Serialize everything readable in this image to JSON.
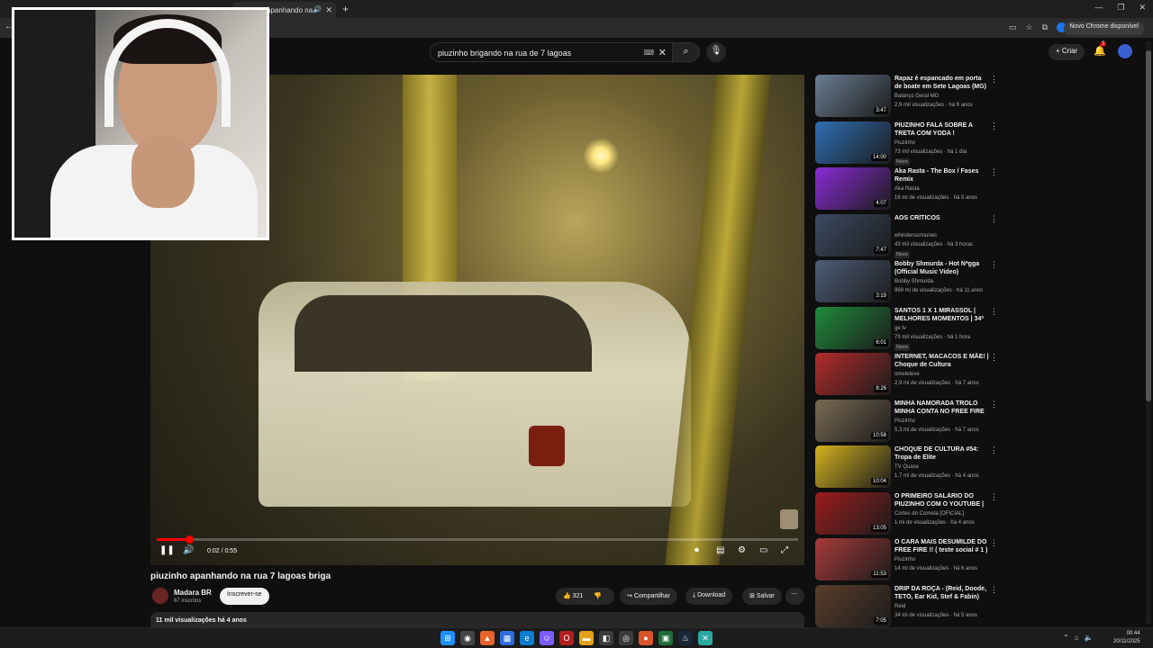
{
  "browser": {
    "tab_title": "pluzinho apanhando na",
    "update_label": "Novo Chrome disponível"
  },
  "youtube": {
    "search_value": "piuzinho brigando na rua de 7 lagoas",
    "create_label": "Criar",
    "notifications_count": "3",
    "video": {
      "title": "piuzinho apanhando na rua 7 lagoas briga",
      "time": "0:02 / 0:55",
      "progress_fraction": 0.05,
      "channel": "Madara BR",
      "subs": "67 inscritos",
      "subscribe": "Inscrever-se",
      "likes": "321",
      "share": "Compartilhar",
      "download": "Download",
      "save": "Salvar",
      "views_date": "11 mil visualizações  há 4 anos"
    },
    "recommendations": [
      {
        "title": "Rapaz é espancado em porta de boate em Sete Lagoas (MG)",
        "channel": "Balanço Geral MG",
        "meta": "2,9 mil visualizações · há 6 anos",
        "duration": "3:47",
        "badge": "",
        "color": "#6a7d92"
      },
      {
        "title": "PIUZINHO FALA SOBRE A TRETA COM YODA !",
        "channel": "Piuzinho",
        "meta": "73 mil visualizações · há 1 dia",
        "duration": "14:00",
        "badge": "Novo",
        "color": "#2f6fb5"
      },
      {
        "title": "Aka Rasta - The Box / Fases Remix",
        "channel": "Aka Rasta",
        "meta": "16 mi de visualizações · há 5 anos",
        "duration": "4:07",
        "badge": "",
        "color": "#8a2bd6"
      },
      {
        "title": "AOS CRÍTICOS",
        "channel": "whindersonnunes",
        "meta": "43 mil visualizações · há 3 horas",
        "duration": "7:47",
        "badge": "Novo",
        "color": "#3b4a63"
      },
      {
        "title": "Bobby Shmurda - Hot N*gga (Official Music Video)",
        "channel": "Bobby Shmurda",
        "meta": "969 mi de visualizações · há 11 anos",
        "duration": "3:19",
        "badge": "",
        "color": "#4d5d78"
      },
      {
        "title": "SANTOS 1 X 1 MIRASSOL | MELHORES MOMENTOS | 34ª ...",
        "channel": "ge tv",
        "meta": "79 mil visualizações · há 1 hora",
        "duration": "6:01",
        "badge": "Novo",
        "color": "#1f8a3b"
      },
      {
        "title": "INTERNET, MACACOS E MÃE! | Choque de Cultura",
        "channel": "omeleteve",
        "meta": "2,9 mi de visualizações · há 7 anos",
        "duration": "8:26",
        "badge": "",
        "color": "#b32b2b"
      },
      {
        "title": "MINHA NAMORADA TROLO MINHA CONTA NO FREE FIRE",
        "channel": "Piuzinho",
        "meta": "5,3 mi de visualizações · há 7 anos",
        "duration": "10:58",
        "badge": "",
        "color": "#7a6a52"
      },
      {
        "title": "CHOQUE DE CULTURA #54: Tropa de Elite",
        "channel": "TV Quase",
        "meta": "1,7 mi de visualizações · há 4 anos",
        "duration": "10:04",
        "badge": "",
        "color": "#d4b21e"
      },
      {
        "title": "O PRIMEIRO SALÁRIO DO PIUZINHO COM O YOUTUBE | ...",
        "channel": "Cortes do Cometa [OFICIAL]",
        "meta": "1 mi de visualizações · há 4 anos",
        "duration": "13:05",
        "badge": "",
        "color": "#9c1c1c"
      },
      {
        "title": "O CARA MAIS DESUMILDE DO FREE FIRE !! ( teste social # 1 )",
        "channel": "Piuzinho",
        "meta": "14 mi de visualizações · há 6 anos",
        "duration": "11:53",
        "badge": "",
        "color": "#a83a3a"
      },
      {
        "title": "DRIP DA ROÇA - (Reid, Doode, TETO, Ear Kid, Stef & Fabin)",
        "channel": "Reid",
        "meta": "34 mi de visualizações · há 5 anos",
        "duration": "7:05",
        "badge": "",
        "color": "#5a3d2a"
      }
    ]
  },
  "taskbar": {
    "time": "00:44",
    "date": "20/11/2025"
  }
}
